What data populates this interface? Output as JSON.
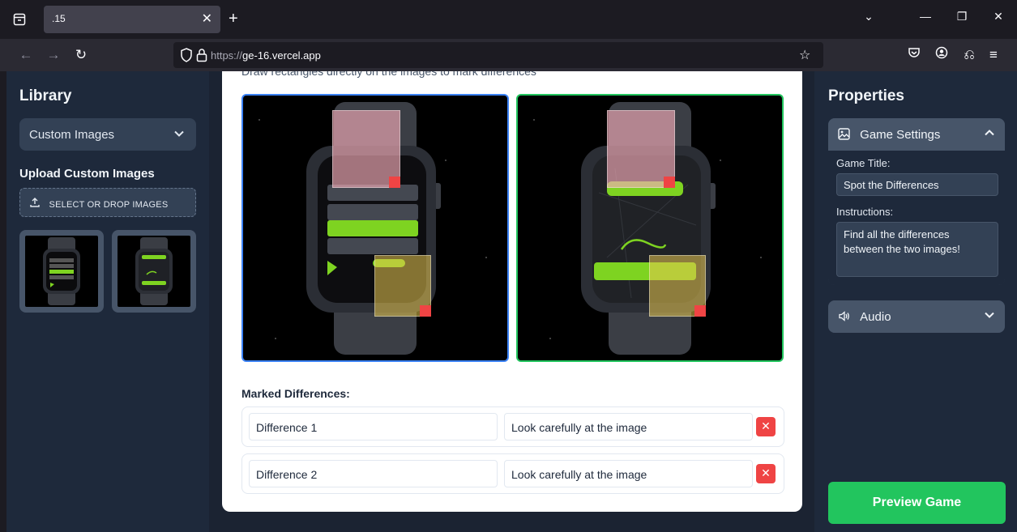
{
  "browser": {
    "tab_title": ".15",
    "url_scheme": "https://",
    "url_host": "ge-16.vercel.app"
  },
  "sidebar": {
    "title": "Library",
    "select_value": "Custom Images",
    "upload_title": "Upload Custom Images",
    "upload_button": "SELECT OR DROP IMAGES"
  },
  "main": {
    "instructions": "Draw rectangles directly on the images to mark differences",
    "marked_title": "Marked Differences:",
    "differences": [
      {
        "name": "Difference 1",
        "hint": "Look carefully at the image"
      },
      {
        "name": "Difference 2",
        "hint": "Look carefully at the image"
      }
    ]
  },
  "properties": {
    "title": "Properties",
    "game_settings_label": "Game Settings",
    "game_title_label": "Game Title:",
    "game_title_value": "Spot the Differences",
    "instructions_label": "Instructions:",
    "instructions_value": "Find all the differences between the two images!",
    "audio_label": "Audio",
    "preview_button": "Preview Game"
  },
  "colors": {
    "accent_green": "#22c55e",
    "left_border": "#3b82f6",
    "delete_red": "#ef4444"
  }
}
